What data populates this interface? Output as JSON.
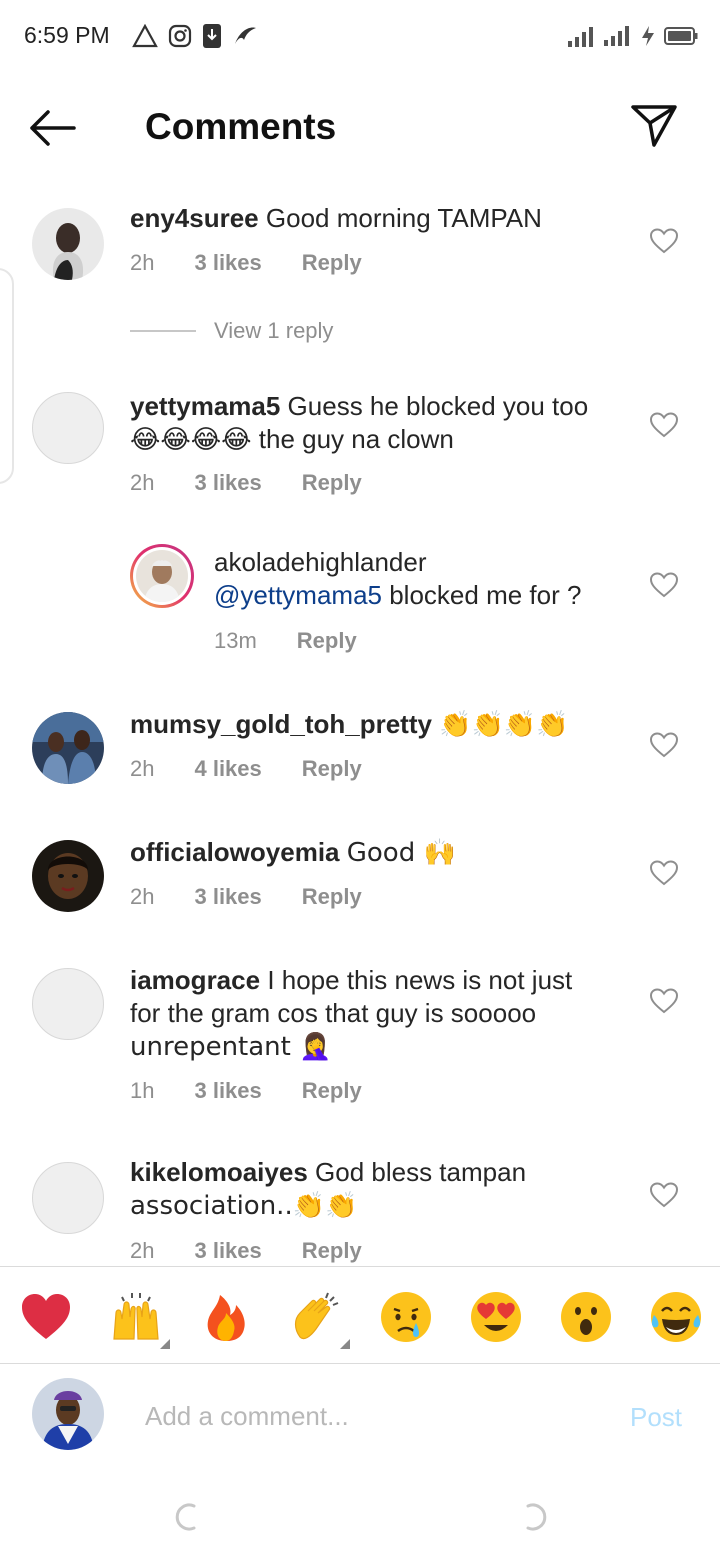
{
  "status_bar": {
    "time": "6:59 PM"
  },
  "header": {
    "title": "Comments",
    "back_icon": "arrow-left-icon",
    "share_icon": "paper-plane-icon"
  },
  "comments": [
    {
      "username": "eny4suree",
      "text": "Good morning TAMPAN",
      "time": "2h",
      "likes": "3 likes",
      "reply": "Reply",
      "view_replies": "View 1 reply"
    },
    {
      "username": "yettymama5",
      "text": "Guess he blocked you too",
      "text_line2_emoji": "😂😂😂😂",
      "text_line2": " the guy na clown",
      "time": "2h",
      "likes": "3 likes",
      "reply": "Reply"
    },
    {
      "username": "akoladehighlander",
      "mention": "@yettymama5",
      "text": " blocked me for ?",
      "time": "13m",
      "reply": "Reply"
    },
    {
      "username": "mumsy_gold_toh_pretty",
      "text": "👏👏👏👏",
      "time": "2h",
      "likes": "4 likes",
      "reply": "Reply"
    },
    {
      "username": "officialowoyemia",
      "text": "Good 🙌",
      "time": "2h",
      "likes": "3 likes",
      "reply": "Reply"
    },
    {
      "username": "iamograce",
      "text": "I hope this news is not just",
      "text_line2": "for the gram cos that guy is sooooo",
      "text_line3": "unrepentant 🤦‍♀️",
      "time": "1h",
      "likes": "3 likes",
      "reply": "Reply"
    },
    {
      "username": "kikelomoaiyes",
      "text": "God bless tampan",
      "text_line2": "association..👏👏",
      "time": "2h",
      "likes": "3 likes",
      "reply": "Reply"
    }
  ],
  "emoji_bar": {
    "emojis": [
      "❤️",
      "🙌",
      "🔥",
      "👏",
      "😢",
      "😍",
      "😮",
      "😂"
    ]
  },
  "composer": {
    "placeholder": "Add a comment...",
    "post_label": "Post"
  },
  "colors": {
    "text": "#262626",
    "muted": "#8e8e8e",
    "mention": "#0d3e8a",
    "post_disabled": "#b2dffc",
    "divider": "#dbdbdb"
  }
}
